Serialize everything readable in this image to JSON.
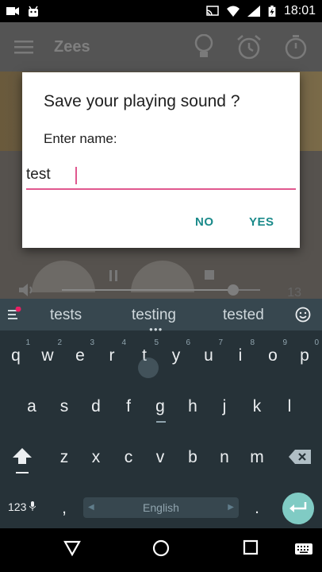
{
  "status_bar": {
    "time": "18:01",
    "left_icons": [
      "video-camera-icon",
      "android-icon"
    ],
    "right_icons": [
      "cast-icon",
      "wifi-icon",
      "signal-icon",
      "battery-charging-icon"
    ]
  },
  "app": {
    "title": "Zees",
    "actions": [
      "lightbulb-icon",
      "alarm-icon",
      "timer-icon"
    ],
    "volume_value": "13"
  },
  "dialog": {
    "title": "Save your playing sound ?",
    "label": "Enter name:",
    "input_value": "test",
    "no_label": "NO",
    "yes_label": "YES",
    "accent_color": "#e0588f",
    "button_color": "#1a8a8a"
  },
  "keyboard": {
    "suggestions": [
      "tests",
      "testing",
      "tested"
    ],
    "row1": [
      {
        "k": "q",
        "h": "1"
      },
      {
        "k": "w",
        "h": "2"
      },
      {
        "k": "e",
        "h": "3"
      },
      {
        "k": "r",
        "h": "4"
      },
      {
        "k": "t",
        "h": "5"
      },
      {
        "k": "y",
        "h": "6"
      },
      {
        "k": "u",
        "h": "7"
      },
      {
        "k": "i",
        "h": "8"
      },
      {
        "k": "o",
        "h": "9"
      },
      {
        "k": "p",
        "h": "0"
      }
    ],
    "row2": [
      "a",
      "s",
      "d",
      "f",
      "g",
      "h",
      "j",
      "k",
      "l"
    ],
    "row3": [
      "z",
      "x",
      "c",
      "v",
      "b",
      "n",
      "m"
    ],
    "symbols_label": "123",
    "comma": ",",
    "space_label": "English",
    "period": "."
  }
}
